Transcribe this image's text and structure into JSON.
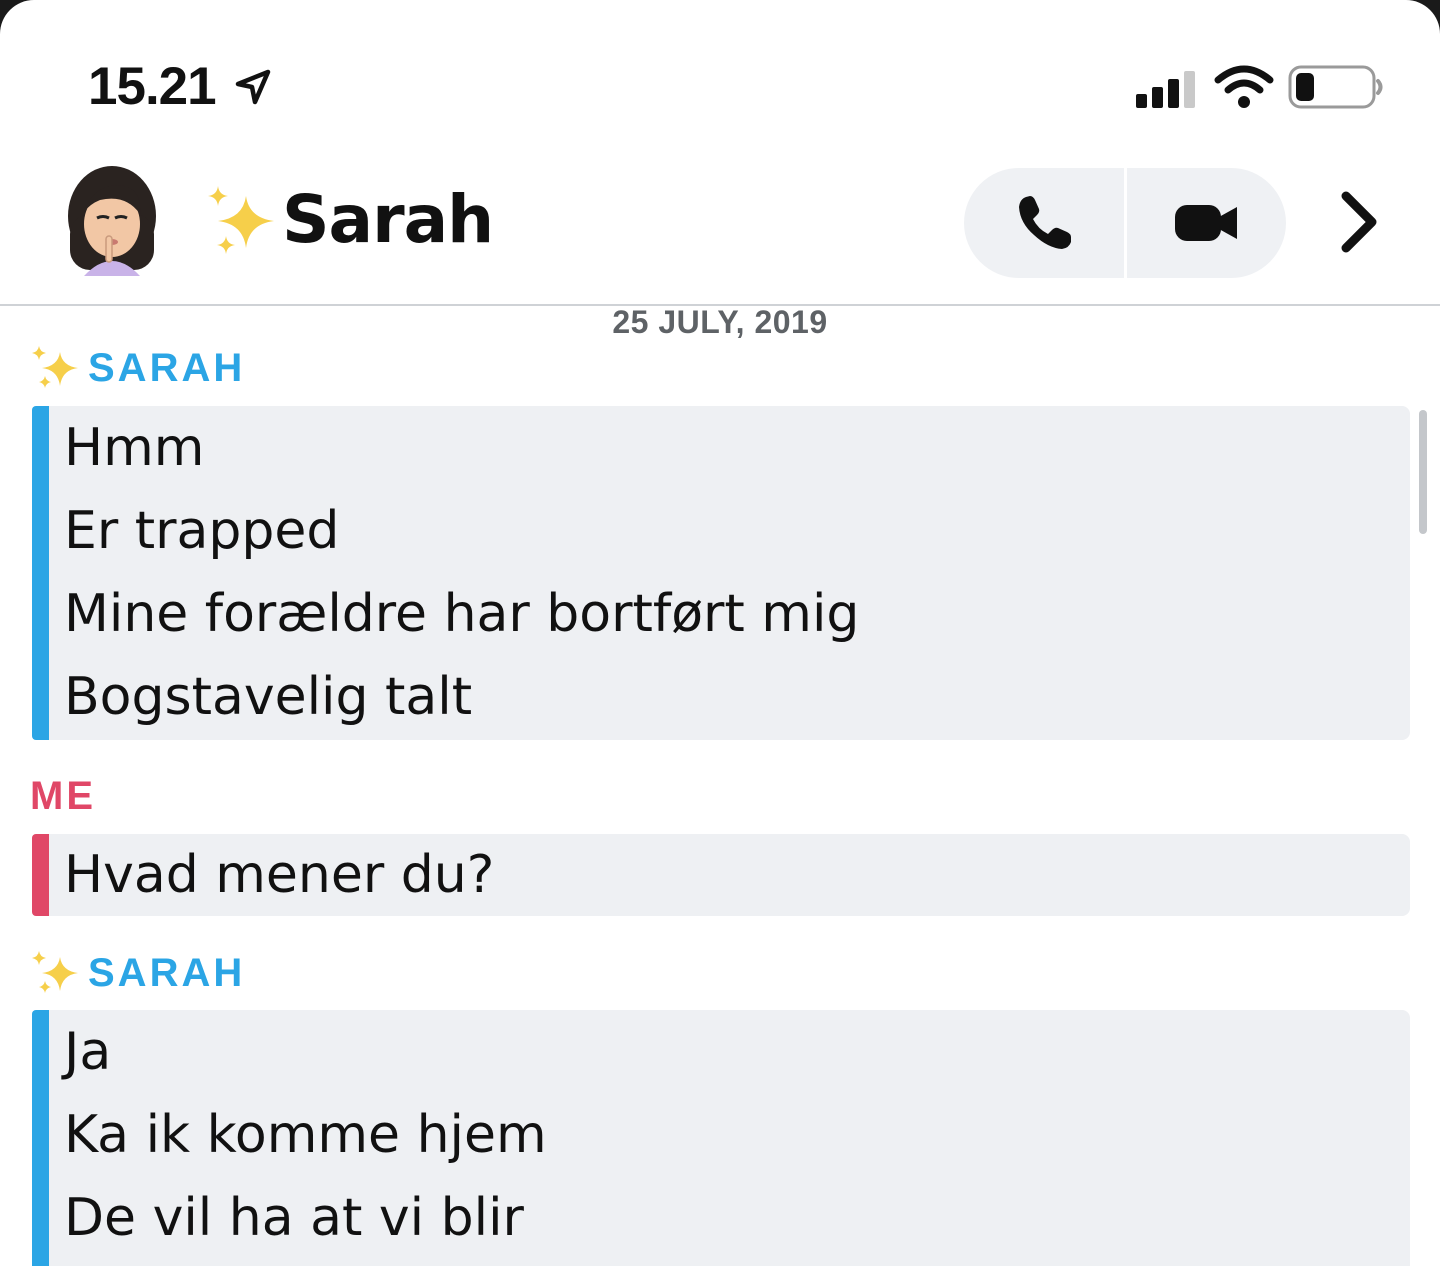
{
  "status_bar": {
    "time": "15.21",
    "icons": [
      "location-arrow-icon",
      "cellular-signal-icon",
      "wifi-icon",
      "battery-icon"
    ]
  },
  "header": {
    "title": "Sarah",
    "title_prefix_icon": "sparkles-icon",
    "avatar_icon": "bitmoji-avatar-icon",
    "actions": [
      "phone-icon",
      "video-camera-icon",
      "chevron-right-icon"
    ]
  },
  "chat": {
    "date": "25 JULY, 2019",
    "groups": [
      {
        "sender": "SARAH",
        "lines": [
          "Hmm",
          "Er trapped",
          "Mine forældre har bortført mig",
          "Bogstavelig talt"
        ]
      },
      {
        "sender": "ME",
        "lines": [
          "Hvad mener du?"
        ]
      },
      {
        "sender": "SARAH",
        "lines": [
          "Ja",
          "Ka ik komme hjem",
          "De vil ha at vi blir"
        ]
      }
    ]
  },
  "colors": {
    "them_accent": "#2ba5e5",
    "me_accent": "#e04767",
    "bubble_bg": "#eef0f3",
    "text": "#111111"
  }
}
